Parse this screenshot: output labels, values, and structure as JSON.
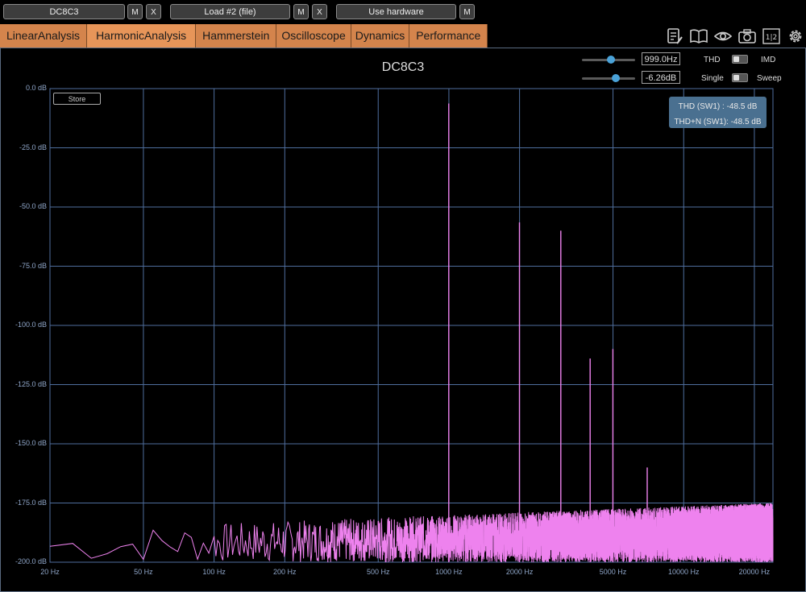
{
  "topbar": {
    "slot1_label": "DC8C3",
    "slot2_label": "Load #2 (file)",
    "slot3_label": "Use hardware",
    "m_label": "M",
    "x_label": "X"
  },
  "tabs": [
    {
      "label": "LinearAnalysis",
      "active": false
    },
    {
      "label": "HarmonicAnalysis",
      "active": true
    },
    {
      "label": "Hammerstein",
      "active": false
    },
    {
      "label": "Oscilloscope",
      "active": false
    },
    {
      "label": "Dynamics",
      "active": false
    },
    {
      "label": "Performance",
      "active": false
    }
  ],
  "toolbar_icons": [
    "notes-icon",
    "book-icon",
    "eye-icon",
    "camera-icon",
    "split-view-icon",
    "gear-icon"
  ],
  "toolbar_split_text": "1|2",
  "controls": {
    "frequency": {
      "value": "999.0Hz",
      "slider_level": 0.55
    },
    "level": {
      "value": "-6.26dB",
      "slider_level": 0.63
    },
    "mode_left": "THD",
    "mode_right": "IMD",
    "sweep_left": "Single",
    "sweep_right": "Sweep"
  },
  "store_label": "Store",
  "readout": {
    "thd": "THD (SW1) : -48.5 dB",
    "thdn": "THD+N (SW1): -48.5 dB"
  },
  "colors": {
    "trace": "#ee82ee",
    "grid": "#4f6e9e",
    "tab": "#d4844c",
    "accent": "#4aa2d8"
  },
  "chart_data": {
    "type": "line",
    "title": "DC8C3",
    "x_scale": "log",
    "xlim": [
      20,
      24000
    ],
    "ylim": [
      -200,
      0
    ],
    "grid": true,
    "y_ticks": [
      0,
      -25,
      -50,
      -75,
      -100,
      -125,
      -150,
      -175,
      -200
    ],
    "y_tick_labels": [
      "0.0 dB",
      "-25.0 dB",
      "-50.0 dB",
      "-75.0 dB",
      "-100.0 dB",
      "-125.0 dB",
      "-150.0 dB",
      "-175.0 dB",
      "-200.0 dB"
    ],
    "x_ticks": [
      20,
      50,
      100,
      200,
      500,
      1000,
      2000,
      5000,
      10000,
      20000
    ],
    "x_tick_labels": [
      "20 Hz",
      "50 Hz",
      "100 Hz",
      "200 Hz",
      "500 Hz",
      "1000 Hz",
      "2000 Hz",
      "5000 Hz",
      "10000 Hz",
      "20000 Hz"
    ],
    "harmonics": [
      {
        "x": 999,
        "y": -6.3
      },
      {
        "x": 1998,
        "y": -56.5
      },
      {
        "x": 2997,
        "y": -60
      },
      {
        "x": 3996,
        "y": -114
      },
      {
        "x": 4995,
        "y": -110
      },
      {
        "x": 6993,
        "y": -160
      }
    ],
    "noise_floor": {
      "low_db": -200,
      "high_db": -175
    }
  }
}
